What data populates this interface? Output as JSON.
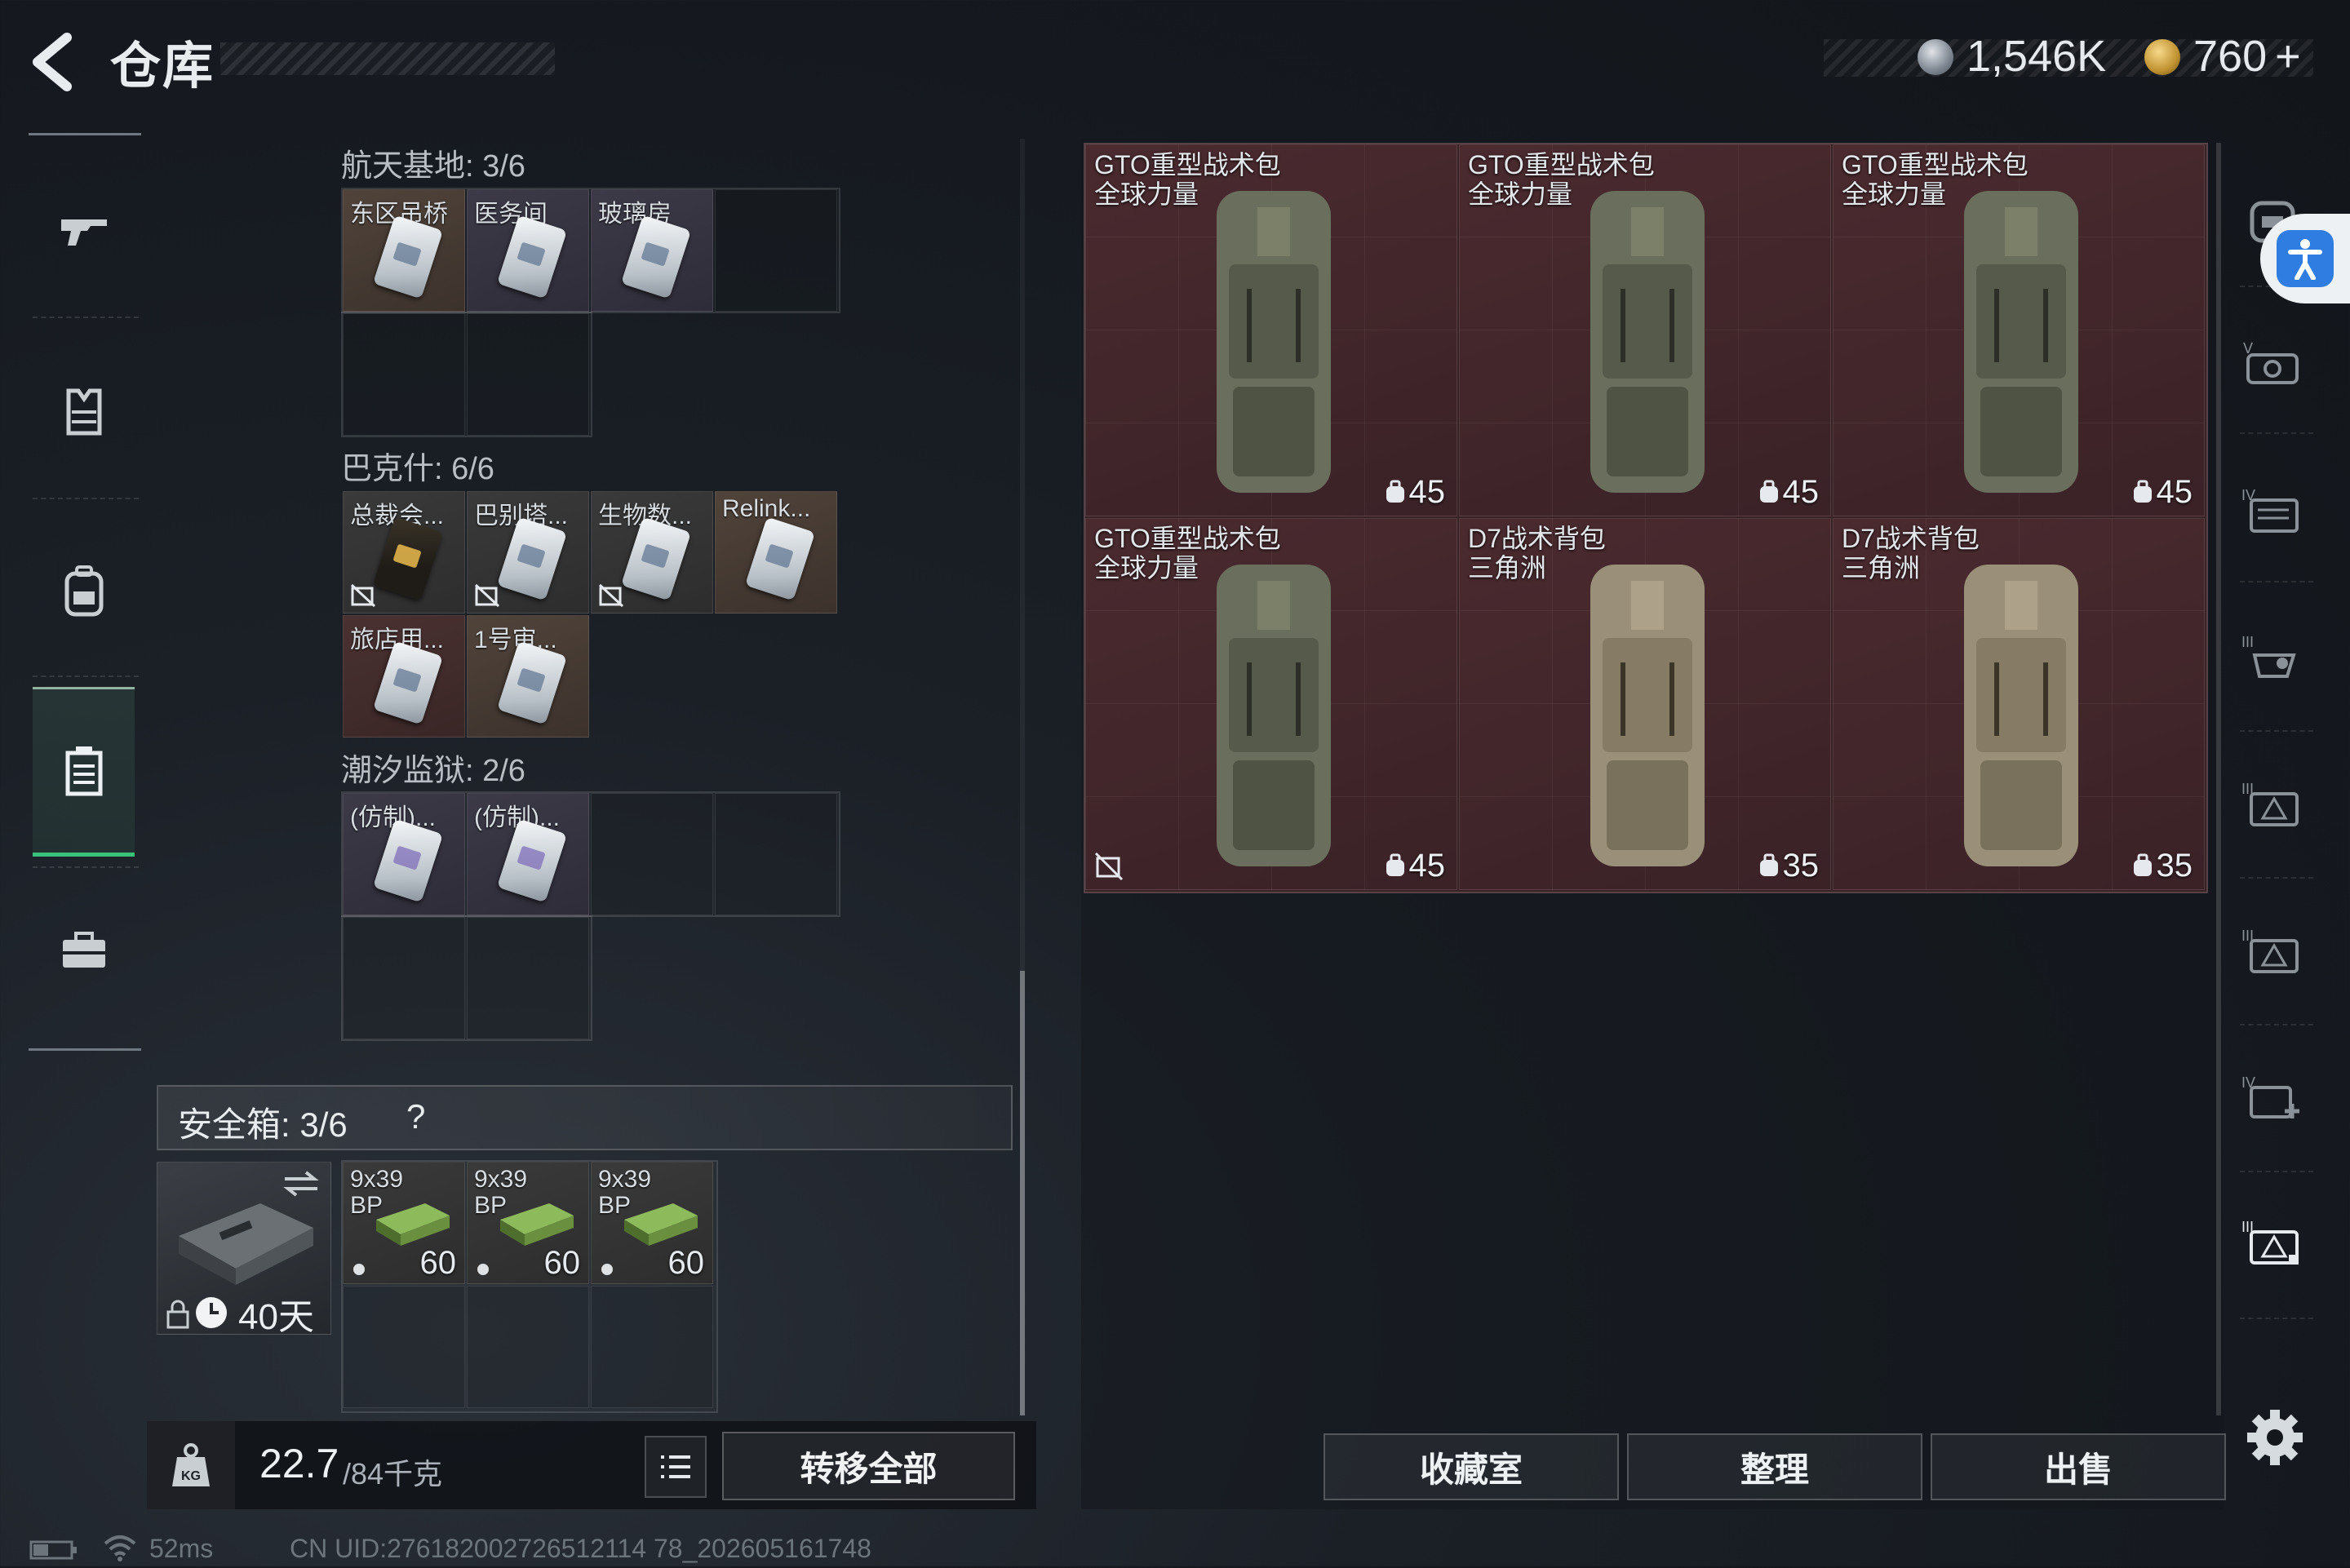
{
  "header": {
    "title": "仓库"
  },
  "currency": {
    "coins": "1,546K",
    "premium": "760",
    "premium_plus": "+"
  },
  "nav": [
    "weapon-icon",
    "armor-icon",
    "backpack-icon",
    "container-icon",
    "briefcase-icon"
  ],
  "stash": {
    "sections": [
      {
        "title": "航天基地: 3/6",
        "items": [
          "东区吊桥",
          "医务间",
          "玻璃房"
        ]
      },
      {
        "title": "巴克什: 6/6",
        "items": [
          "总裁会...",
          "巴别塔...",
          "生物数...",
          "Relink...",
          "旅店用...",
          "1号审..."
        ]
      },
      {
        "title": "潮汐监狱: 2/6",
        "items": [
          "(仿制)...",
          "(仿制)..."
        ]
      }
    ],
    "safe_label": "安全箱:  3/6",
    "safe_help": "?",
    "safe_days": "40天",
    "ammo": [
      {
        "line1": "9x39",
        "line2": "BP",
        "qty": "60"
      },
      {
        "line1": "9x39",
        "line2": "BP",
        "qty": "60"
      },
      {
        "line1": "9x39",
        "line2": "BP",
        "qty": "60"
      }
    ],
    "weight_value": "22.7",
    "weight_max": "/84千克",
    "transfer_all": "转移全部"
  },
  "bags": [
    {
      "name1": "GTO重型战术包",
      "name2": "全球力量",
      "capacity": "45",
      "color": "#6a6e5c"
    },
    {
      "name1": "GTO重型战术包",
      "name2": "全球力量",
      "capacity": "45",
      "color": "#6a6e5c"
    },
    {
      "name1": "GTO重型战术包",
      "name2": "全球力量",
      "capacity": "45",
      "color": "#6a6e5c"
    },
    {
      "name1": "GTO重型战术包",
      "name2": "全球力量",
      "capacity": "45",
      "color": "#6a6e5c"
    },
    {
      "name1": "D7战术背包",
      "name2": "三角洲",
      "capacity": "35",
      "color": "#9a8f78"
    },
    {
      "name1": "D7战术背包",
      "name2": "三角洲",
      "capacity": "35",
      "color": "#9a8f78"
    }
  ],
  "actions": {
    "collection": "收藏室",
    "sort": "整理",
    "sell": "出售"
  },
  "status": {
    "ping": "52ms",
    "uid": "CN UID:276182002726512114 78_202605161748"
  }
}
